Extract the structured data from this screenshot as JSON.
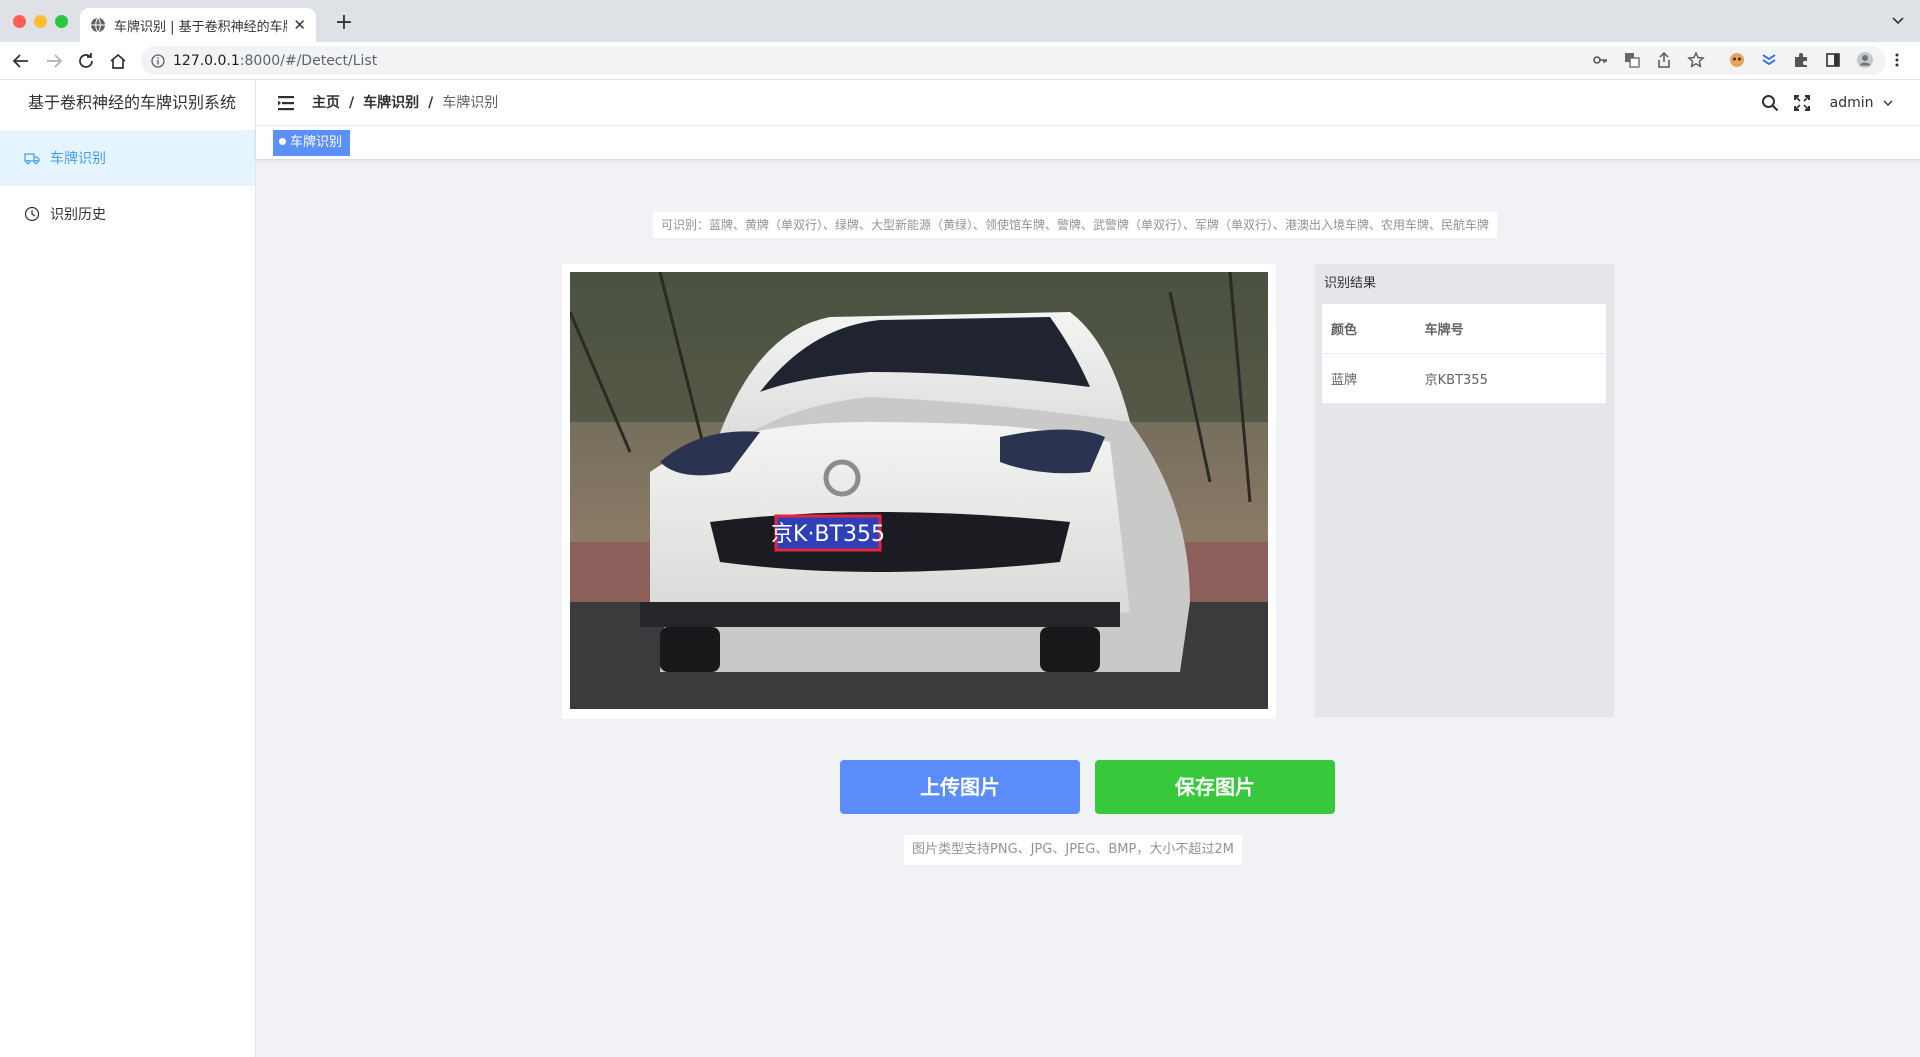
{
  "browser": {
    "tab_title": "车牌识别 | 基于卷积神经的车牌识别系统",
    "url_host": "127.0.0.1",
    "url_path": ":8000/#/Detect/List"
  },
  "sidebar": {
    "brand": "基于卷积神经的车牌识别系统",
    "items": [
      {
        "label": "车牌识别",
        "icon": "truck-icon",
        "active": true
      },
      {
        "label": "识别历史",
        "icon": "clock-icon",
        "active": false
      }
    ]
  },
  "header": {
    "breadcrumb": [
      "主页",
      "车牌识别",
      "车牌识别"
    ],
    "user": "admin"
  },
  "tags": {
    "active_tag": "车牌识别"
  },
  "main": {
    "hint_top": "可识别：蓝牌、黄牌（单双行）、绿牌、大型新能源（黄绿）、领使馆车牌、警牌、武警牌（单双行）、军牌（单双行）、港澳出入境车牌、农用车牌、民航车牌",
    "plate_overlay": "京K·BT355",
    "result": {
      "title": "识别结果",
      "headers": [
        "颜色",
        "车牌号"
      ],
      "rows": [
        [
          "蓝牌",
          "京KBT355"
        ]
      ]
    },
    "upload_button": "上传图片",
    "save_button": "保存图片",
    "hint_bottom": "图片类型支持PNG、JPG、JPEG、BMP，大小不超过2M"
  },
  "colors": {
    "accent": "#409eff",
    "upload": "#5a8dfa",
    "save": "#37c83c",
    "plate_box": "#e8253a"
  }
}
